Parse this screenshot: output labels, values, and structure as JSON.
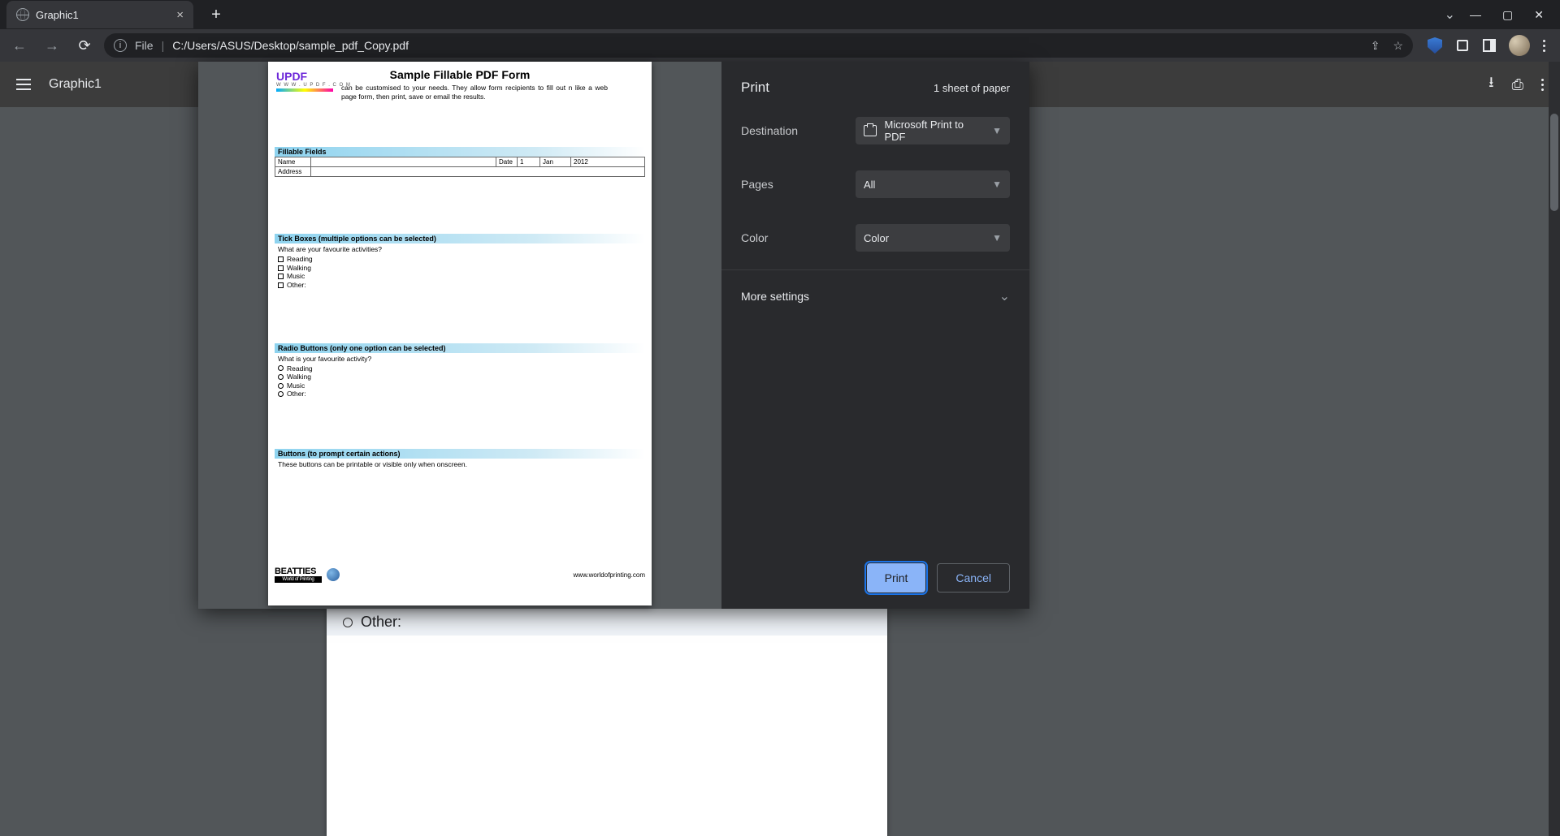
{
  "browser": {
    "tab_title": "Graphic1",
    "file_label": "File",
    "path": "C:/Users/ASUS/Desktop/sample_pdf_Copy.pdf"
  },
  "pdf_toolbar": {
    "title": "Graphic1"
  },
  "bottom_strip": {
    "other_label": "Other:"
  },
  "preview": {
    "title": "Sample Fillable PDF Form",
    "logo_text": "UPDF",
    "logo_sub": "W W W . U P D F . C O M",
    "intro_line1": "can be customised to your needs. They allow form recipients to fill out",
    "intro_line2": "n like a web page form, then print, save or email the results.",
    "sec_fillable": "Fillable Fields",
    "table": {
      "name_lbl": "Name",
      "date_lbl": "Date",
      "day": "1",
      "month": "Jan",
      "year": "2012",
      "addr_lbl": "Address"
    },
    "sec_tick": "Tick Boxes (multiple options can be selected)",
    "tick_q": "What are your favourite activities?",
    "opts": [
      "Reading",
      "Walking",
      "Music",
      "Other:"
    ],
    "sec_radio": "Radio Buttons (only one option can be selected)",
    "radio_q": "What is your favourite activity?",
    "sec_buttons": "Buttons (to prompt certain actions)",
    "buttons_note": "These buttons can be printable or visible only when onscreen.",
    "footer_brand": "BEATTIES",
    "footer_tag": "World of Printing",
    "footer_url": "www.worldofprinting.com"
  },
  "print": {
    "heading": "Print",
    "sheet_count": "1 sheet of paper",
    "destination_lbl": "Destination",
    "destination_val": "Microsoft Print to PDF",
    "pages_lbl": "Pages",
    "pages_val": "All",
    "color_lbl": "Color",
    "color_val": "Color",
    "more_lbl": "More settings",
    "print_btn": "Print",
    "cancel_btn": "Cancel"
  }
}
